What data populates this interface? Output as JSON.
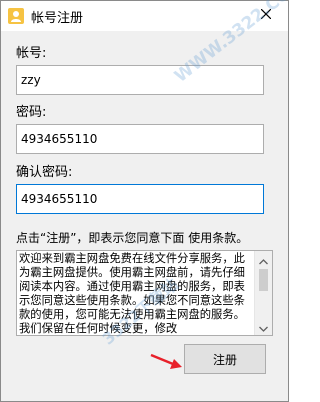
{
  "window": {
    "title": "帐号注册",
    "icon": "user-icon",
    "close_icon": "close-icon"
  },
  "form": {
    "username_label": "帐号:",
    "username_value": "zzy",
    "password_label": "密码:",
    "password_value": "4934655110",
    "confirm_label": "确认密码:",
    "confirm_value": "4934655110"
  },
  "terms": {
    "notice": "点击“注册”，即表示您同意下面 使用条款。",
    "text": "欢迎来到霸主网盘免费在线文件分享服务，此为霸主网盘提供。使用霸主网盘前，请先仔细阅读本内容。通过使用霸主网盘的服务，即表示您同意这些使用条款。如果您不同意这些条款的使用，您可能无法使用霸主网盘的服务。我们保留在任何时候变更，修改"
  },
  "actions": {
    "register_label": "注册"
  },
  "watermark": {
    "text": "WWW.3322.CC",
    "text2": "3322下载站"
  },
  "colors": {
    "focus_border": "#0078d7",
    "arrow": "#e8202a"
  }
}
